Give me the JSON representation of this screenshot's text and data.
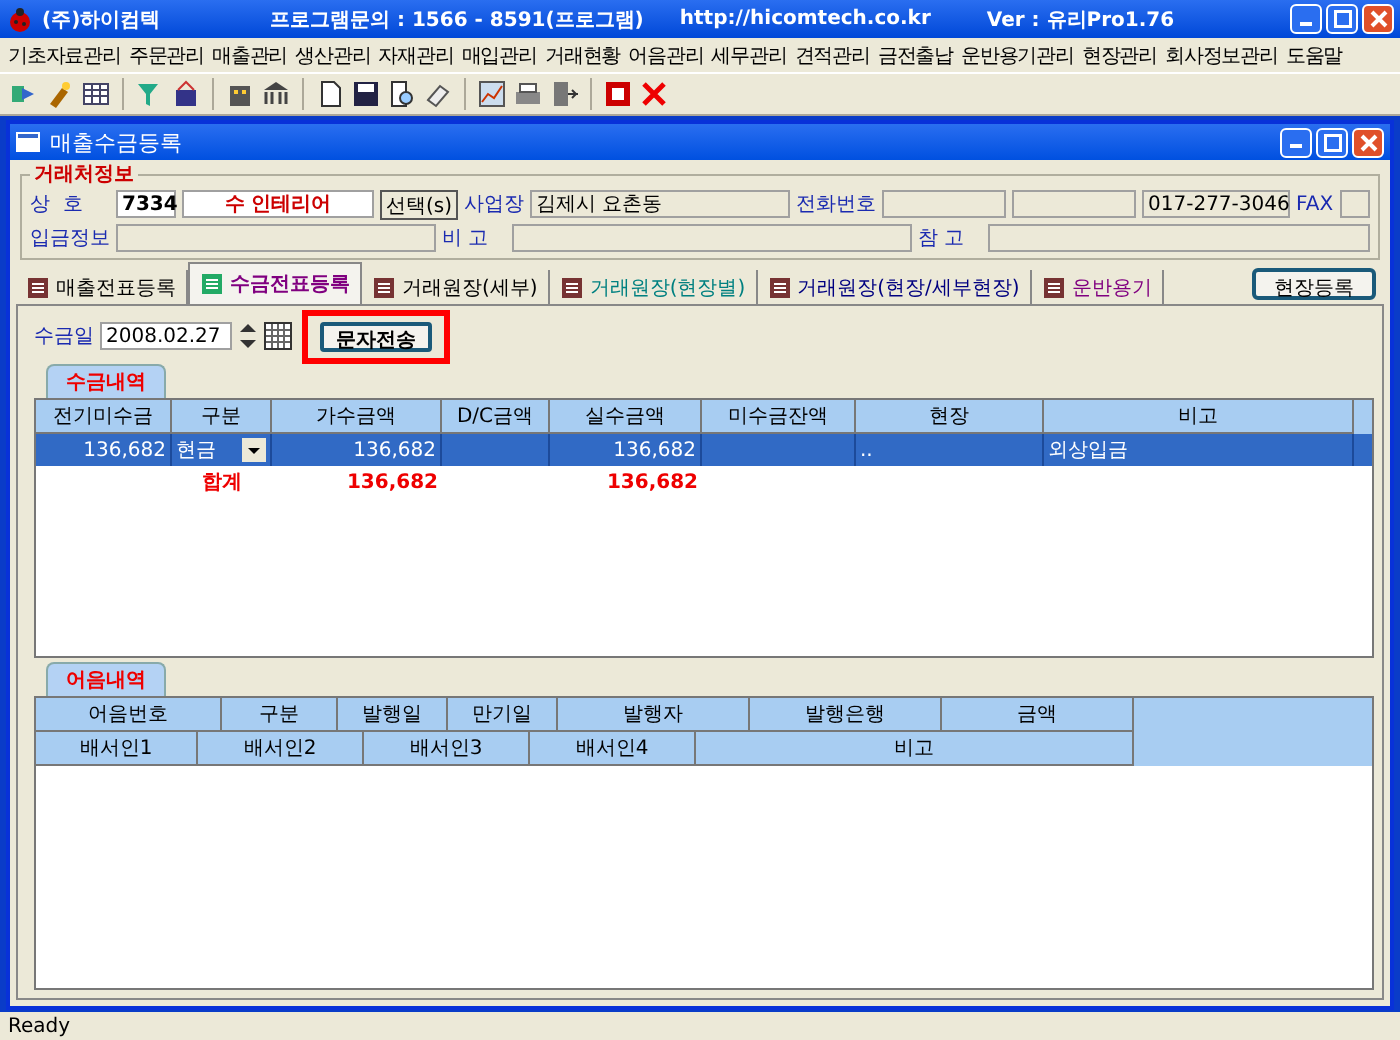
{
  "app_window": {
    "title": "(주)하이컴텍",
    "contact": "프로그램문의 : 1566 - 8591(프로그램)",
    "url": "http://hicomtech.co.kr",
    "version": "Ver : 유리Pro1.76"
  },
  "menu": [
    "기초자료관리",
    "주문관리",
    "매출관리",
    "생산관리",
    "자재관리",
    "매입관리",
    "거래현황",
    "어음관리",
    "세무관리",
    "견적관리",
    "금전출납",
    "운반용기관리",
    "현장관리",
    "회사정보관리",
    "도움말"
  ],
  "document_window": {
    "title": "매출수금등록"
  },
  "customer_info": {
    "legend": "거래처정보",
    "name_label": "상  호",
    "code": "7334",
    "name": "수 인테리어",
    "select_button": "선택(s)",
    "business_label": "사업장",
    "business": "김제시 요촌동",
    "phone_label": "전화번호",
    "mobile": "017-277-3046",
    "fax_label": "FAX",
    "deposit_label": "입금정보",
    "memo_label": "비  고",
    "note_label": "참  고"
  },
  "tabs": [
    {
      "label": "매출전표등록",
      "selected": false,
      "color": "#000000"
    },
    {
      "label": "수금전표등록",
      "selected": true,
      "color": "#800080"
    },
    {
      "label": "거래원장(세부)",
      "selected": false,
      "color": "#000000"
    },
    {
      "label": "거래원장(현장별)",
      "selected": false,
      "color": "#008080"
    },
    {
      "label": "거래원장(현장/세부현장)",
      "selected": false,
      "color": "#000080"
    },
    {
      "label": "운반용기",
      "selected": false,
      "color": "#800080"
    }
  ],
  "site_register_button": "현장등록",
  "receipt_date": {
    "label": "수금일",
    "value": "2008.02.27"
  },
  "sms_button": {
    "label": "문자전송",
    "highlighted": true
  },
  "receipts": {
    "tab": "수금내역",
    "columns": [
      "전기미수금",
      "구분",
      "가수금액",
      "D/C금액",
      "실수금액",
      "미수금잔액",
      "현장",
      "비고"
    ],
    "rows": [
      {
        "selected": true,
        "cells": [
          "136,682",
          "현금",
          "136,682",
          "",
          "136,682",
          "",
          "..",
          "외상입금"
        ]
      }
    ],
    "total": {
      "label": "합계",
      "advance_amount": "136,682",
      "actual_amount": "136,682"
    }
  },
  "notes": {
    "tab": "어음내역",
    "columns_row_1": [
      "어음번호",
      "구분",
      "발행일",
      "만기일",
      "발행자",
      "발행은행",
      "금액"
    ],
    "columns_row_2": [
      "배서인1",
      "배서인2",
      "배서인3",
      "배서인4",
      "비고"
    ]
  },
  "status_bar": "Ready"
}
